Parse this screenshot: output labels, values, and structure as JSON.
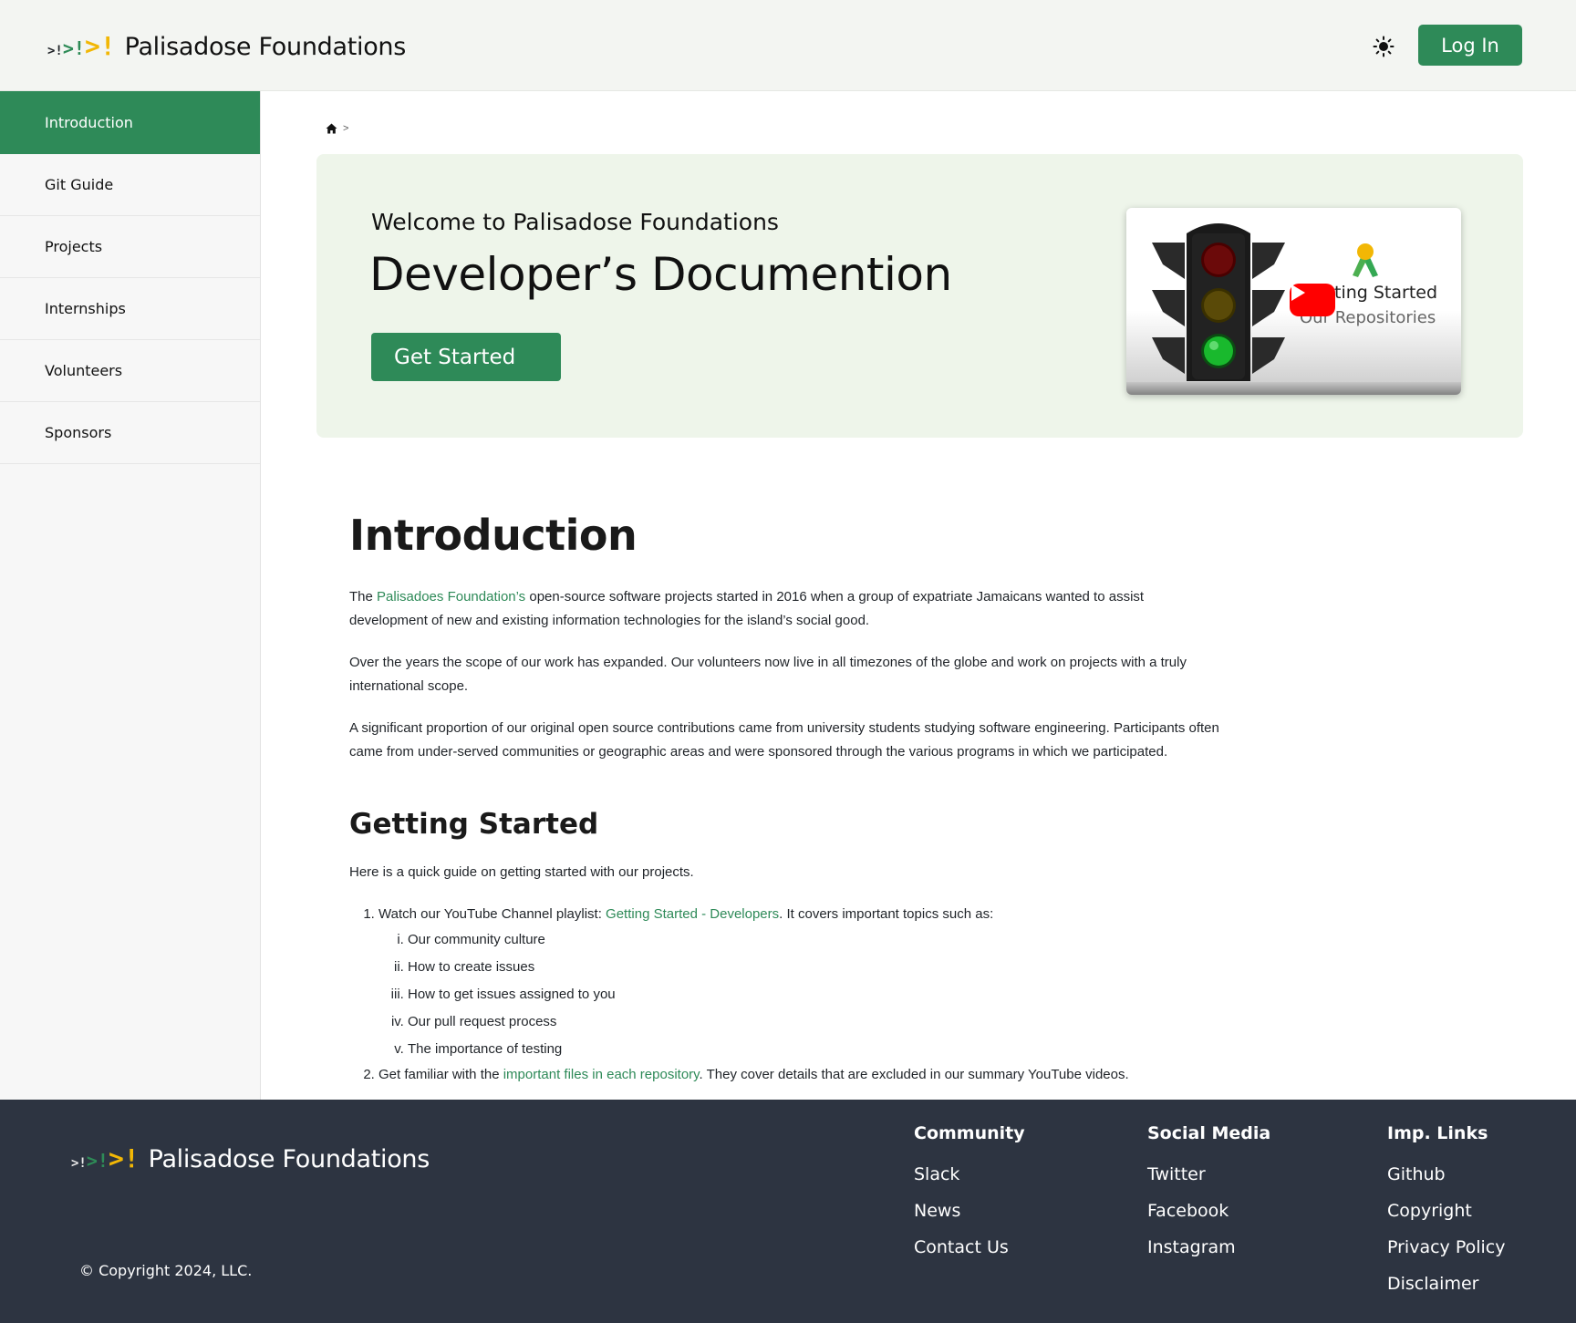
{
  "brand": {
    "mark_1": ">!",
    "mark_2": ">!",
    "mark_3": ">!",
    "name": "Palisadose Foundations"
  },
  "header": {
    "theme_icon": "sun-icon",
    "login_label": "Log In"
  },
  "sidebar": {
    "items": [
      {
        "label": "Introduction",
        "active": true
      },
      {
        "label": "Git Guide"
      },
      {
        "label": "Projects"
      },
      {
        "label": "Internships"
      },
      {
        "label": "Volunteers"
      },
      {
        "label": "Sponsors"
      }
    ]
  },
  "breadcrumb": {
    "home_icon": "home-icon",
    "separator": ">"
  },
  "hero": {
    "subtitle": "Welcome to Palisadose Foundations",
    "title": "Developer’s Documention",
    "button_label": "Get Started",
    "video": {
      "title": "ting Started",
      "subtitle": "Our Repositories"
    }
  },
  "content": {
    "h1": "Introduction",
    "p1_before": "The ",
    "p1_link": "Palisadoes Foundation’s",
    "p1_after": " open-source software projects started in 2016 when a group of expatriate Jamaicans wanted to assist development of new and existing information technologies for the island’s social good.",
    "p2": "Over the years the scope of our work has expanded. Our volunteers now live in all timezones of the globe and work on projects with a truly international scope.",
    "p3": "A significant proportion of our original open source contributions came from university students studying software engineering. Participants often came from under-served communities or geographic areas and were sponsored through the various programs in which we participated.",
    "h2": "Getting Started",
    "p4": "Here is a quick guide on getting started with our projects.",
    "step1_before": "Watch our YouTube Channel playlist: ",
    "step1_link": "Getting Started - Developers",
    "step1_after": ". It covers important topics such as:",
    "step1_topics": [
      "Our community culture",
      "How to create issues",
      "How to get issues assigned to you",
      "Our pull request process",
      "The importance of testing"
    ],
    "step2_before": "Get familiar with the ",
    "step2_link": "important files in each repository",
    "step2_after": ". They cover details that are excluded in our summary YouTube videos."
  },
  "footer": {
    "columns": [
      {
        "heading": "Community",
        "links": [
          "Slack",
          "News",
          "Contact Us"
        ]
      },
      {
        "heading": "Social Media",
        "links": [
          "Twitter",
          "Facebook",
          "Instagram"
        ]
      },
      {
        "heading": "Imp. Links",
        "links": [
          "Github",
          "Copyright",
          "Privacy Policy",
          "Disclaimer"
        ]
      }
    ],
    "copyright": "© Copyright 2024, LLC."
  },
  "colors": {
    "accent": "#2e8a58",
    "logo_yellow": "#f2b705",
    "hero_bg": "#eef5ea",
    "footer_bg": "#2d3441"
  }
}
